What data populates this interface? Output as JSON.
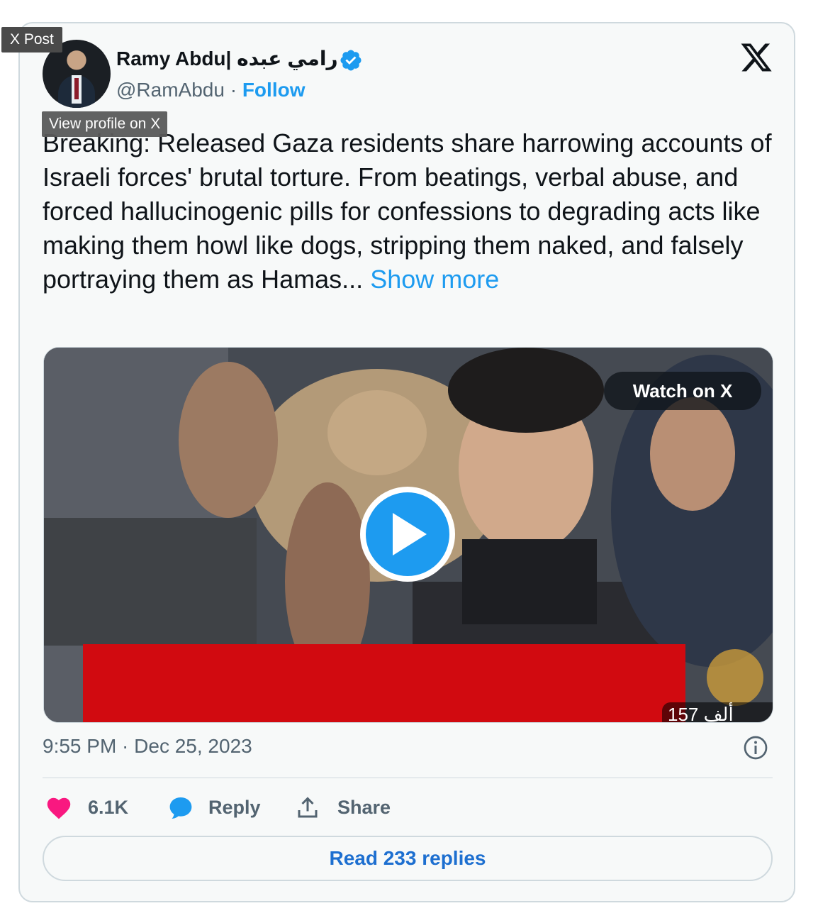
{
  "embed": {
    "tooltip_label": "X Post",
    "profile_tooltip": "View profile on X"
  },
  "author": {
    "display_name": "Ramy Abdu| رامي عبده",
    "handle": "@RamAbdu",
    "separator": "·",
    "follow_label": "Follow",
    "verified": true
  },
  "post": {
    "text": "Breaking: Released Gaza residents share harrowing accounts of Israeli forces' brutal torture. From beatings, verbal abuse, and forced hallucinogenic pills for confessions to degrading acts like making them howl like dogs, stripping them naked, and falsely portraying them as Hamas...",
    "show_more_label": "Show more",
    "timestamp": "9:55 PM · Dec 25, 2023"
  },
  "media": {
    "watch_label": "Watch on X",
    "view_count": "157 ألف"
  },
  "actions": {
    "like_count": "6.1K",
    "reply_label": "Reply",
    "share_label": "Share"
  },
  "footer": {
    "read_replies_label": "Read 233 replies"
  },
  "colors": {
    "accent": "#1d9bf0",
    "like": "#f91880",
    "text_primary": "#0f1419",
    "text_secondary": "#536471",
    "border": "#cfd9de",
    "background": "#f7f9f9",
    "banner_red": "#d10a10"
  },
  "icons": {
    "verified": "verified-badge-icon",
    "platform": "x-logo-icon",
    "play": "play-icon",
    "info": "info-icon",
    "like": "heart-icon",
    "reply": "speech-bubble-icon",
    "share": "share-upload-icon"
  }
}
